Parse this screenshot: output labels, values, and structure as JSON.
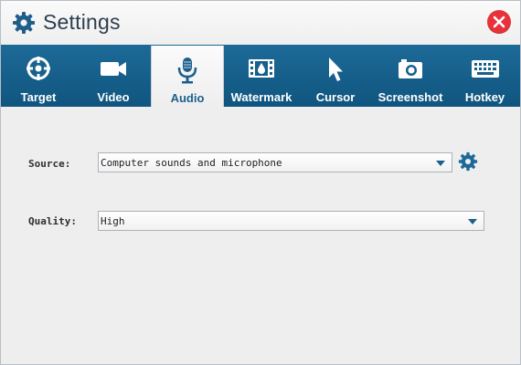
{
  "window": {
    "title": "Settings",
    "title_icon": "gear-icon",
    "close_icon": "close-icon"
  },
  "tabs": [
    {
      "label": "Target",
      "icon": "target-icon",
      "active": false
    },
    {
      "label": "Video",
      "icon": "video-camera-icon",
      "active": false
    },
    {
      "label": "Audio",
      "icon": "microphone-icon",
      "active": true
    },
    {
      "label": "Watermark",
      "icon": "watermark-film-icon",
      "active": false
    },
    {
      "label": "Cursor",
      "icon": "cursor-arrow-icon",
      "active": false
    },
    {
      "label": "Screenshot",
      "icon": "camera-icon",
      "active": false
    },
    {
      "label": "Hotkey",
      "icon": "keyboard-icon",
      "active": false
    }
  ],
  "audio": {
    "source_label": "Source:",
    "source_value": "Computer sounds and microphone",
    "quality_label": "Quality:",
    "quality_value": "High"
  },
  "colors": {
    "tabbar": "#15608c",
    "accent": "#1d5f8c",
    "close": "#e8323a"
  }
}
